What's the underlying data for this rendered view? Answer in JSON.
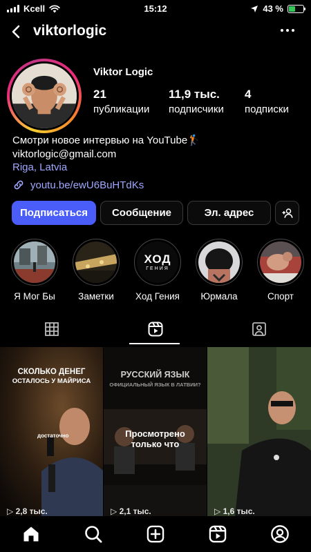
{
  "status_bar": {
    "carrier": "Kcell",
    "time": "15:12",
    "battery_text": "43 %",
    "battery_level": 0.43
  },
  "header": {
    "username": "viktorlogic",
    "icons": [
      "back-arrow-icon",
      "more-options-icon"
    ]
  },
  "profile": {
    "display_name": "Viktor Logic",
    "stats": [
      {
        "value": "21",
        "label": "публикации"
      },
      {
        "value": "11,9 тыс.",
        "label": "подписчики"
      },
      {
        "value": "4",
        "label": "подписки"
      }
    ],
    "bio_line1": "Смотри новое интервью на YouTube🏌",
    "email": "viktorlogic@gmail.com",
    "location": "Riga, Latvia",
    "link": "youtu.be/ewU6BuHTdKs"
  },
  "actions": {
    "follow": "Подписаться",
    "message": "Сообщение",
    "email": "Эл. адрес",
    "suggest_icon": "add-person-icon"
  },
  "highlights": [
    {
      "label": "Я Мог Бы"
    },
    {
      "label": "Заметки"
    },
    {
      "label": "Ход Гения",
      "logo_line1": "ХОД",
      "logo_line2": "ГЕНИЯ"
    },
    {
      "label": "Юрмала"
    },
    {
      "label": "Спорт"
    }
  ],
  "tabs": [
    "grid-icon",
    "reels-icon",
    "tagged-icon"
  ],
  "posts": [
    {
      "title": "СКОЛЬКО ДЕНЕГ",
      "subtitle": "ОСТАЛОСЬ У МАЙРИСА",
      "caption": "достаточно",
      "count": "▷ 2,8 тыс."
    },
    {
      "title": "РУССКИЙ ЯЗЫК",
      "subtitle": "ОФИЦИАЛЬНЫЙ ЯЗЫК В ЛАТВИИ?",
      "overlay": "Просмотрено только что",
      "count": "▷ 2,1 тыс."
    },
    {
      "count": "▷ 1,6 тыс."
    }
  ],
  "bottom_nav": [
    "home-icon",
    "search-icon",
    "create-icon",
    "reels-icon",
    "profile-icon"
  ],
  "colors": {
    "accent": "#4a5df9",
    "link": "#a0a8ff",
    "background": "#000000"
  }
}
